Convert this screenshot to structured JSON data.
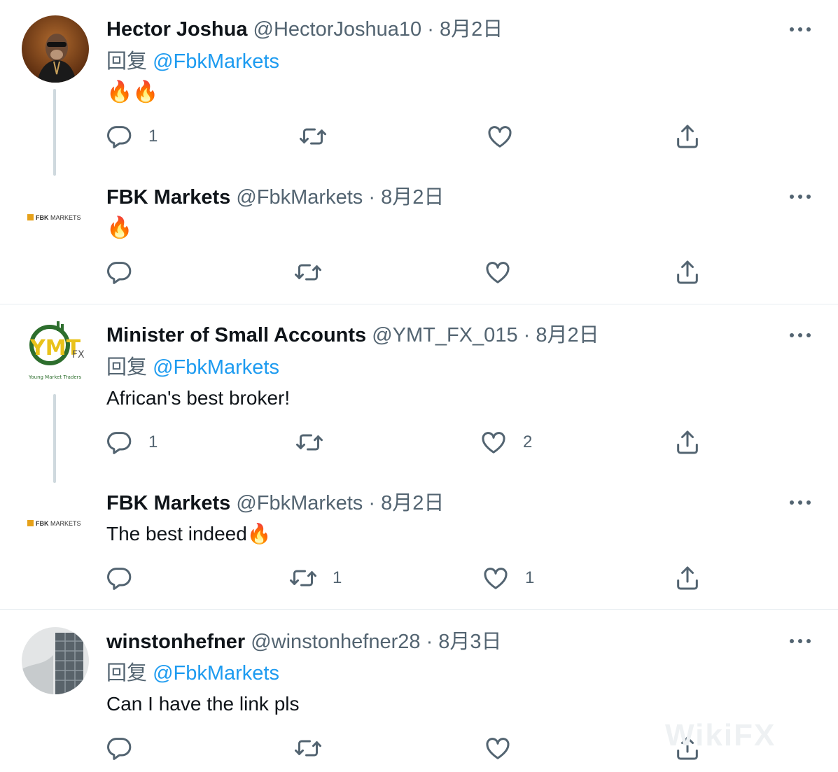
{
  "colors": {
    "mention": "#1d9bf0",
    "secondary_text": "#536471",
    "primary_text": "#0f1419",
    "thread_line": "#cfd9de"
  },
  "reply_prefix": "回复",
  "tweets": [
    {
      "name": "Hector Joshua",
      "handle": "@HectorJoshua10",
      "date": "8月2日",
      "reply_to": "@FbkMarkets",
      "text": "🔥🔥",
      "replies": "1",
      "retweets": "",
      "likes": ""
    },
    {
      "name": "FBK Markets",
      "handle": "@FbkMarkets",
      "date": "8月2日",
      "text": "🔥",
      "replies": "",
      "retweets": "",
      "likes": ""
    },
    {
      "name": "Minister of Small Accounts",
      "handle": "@YMT_FX_015",
      "date": "8月2日",
      "reply_to": "@FbkMarkets",
      "text": "African's best broker!",
      "replies": "1",
      "retweets": "",
      "likes": "2"
    },
    {
      "name": "FBK Markets",
      "handle": "@FbkMarkets",
      "date": "8月2日",
      "text": "The best indeed🔥",
      "replies": "",
      "retweets": "1",
      "likes": "1"
    },
    {
      "name": "winstonhefner",
      "handle": "@winstonhefner28",
      "date": "8月3日",
      "reply_to": "@FbkMarkets",
      "text": "Can I have the link pls",
      "replies": "",
      "retweets": "",
      "likes": ""
    }
  ],
  "fbk_logo": {
    "bold": "FBK",
    "rest": "MARKETS"
  },
  "ymt_logo": {
    "main": "YMT",
    "fx": "FX",
    "tagline": "Young Market Traders"
  },
  "watermark": "WikiFX",
  "icons": {
    "reply": "reply-icon",
    "retweet": "retweet-icon",
    "like": "like-icon",
    "share": "share-icon",
    "more": "more-icon"
  }
}
